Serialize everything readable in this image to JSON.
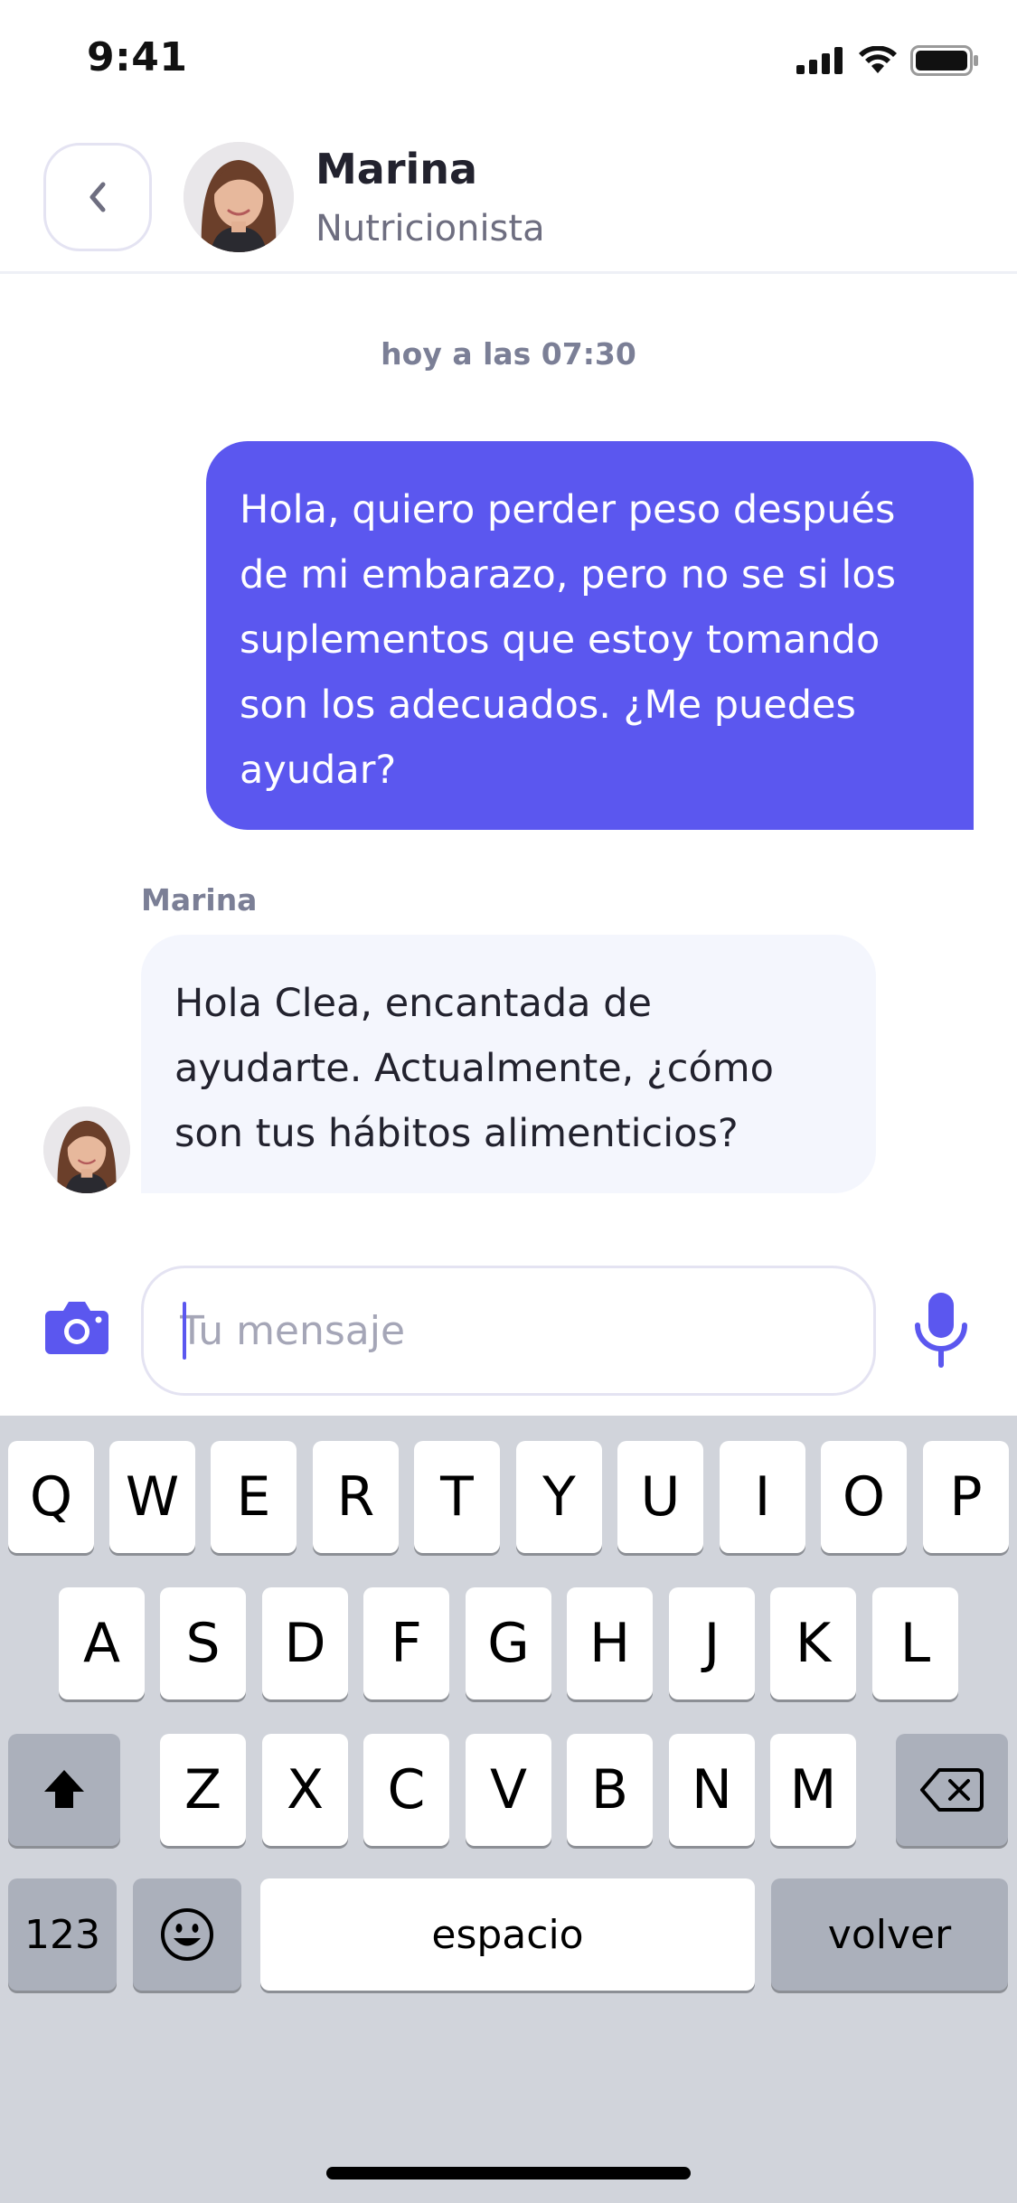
{
  "status_bar": {
    "time": "9:41"
  },
  "header": {
    "contact_name": "Marina",
    "contact_role": "Nutricionista"
  },
  "conversation": {
    "timestamp": "hoy a las 07:30",
    "messages": [
      {
        "direction": "outgoing",
        "text": "Hola, quiero perder peso después de mi embarazo, pero no se si los suplementos que estoy tomando son los adecuados. ¿Me puedes ayudar?"
      },
      {
        "direction": "incoming",
        "sender": "Marina",
        "text": "Hola Clea, encantada de ayudarte. Actualmente, ¿cómo son tus hábitos alimenticios?"
      }
    ]
  },
  "composer": {
    "placeholder": "Tu mensaje",
    "value": "",
    "camera_icon": "camera-icon",
    "mic_icon": "microphone-icon"
  },
  "keyboard": {
    "row1": [
      "Q",
      "W",
      "E",
      "R",
      "T",
      "Y",
      "U",
      "I",
      "O",
      "P"
    ],
    "row2": [
      "A",
      "S",
      "D",
      "F",
      "G",
      "H",
      "J",
      "K",
      "L"
    ],
    "row3": [
      "Z",
      "X",
      "C",
      "V",
      "B",
      "N",
      "M"
    ],
    "numbers_label": "123",
    "space_label": "espacio",
    "return_label": "volver",
    "shift_icon": "shift-icon",
    "delete_icon": "backspace-icon",
    "emoji_icon": "emoji-icon"
  },
  "colors": {
    "accent": "#5b57ef",
    "incoming_bubble": "#f4f6fd",
    "keyboard_bg": "#d1d4db"
  }
}
